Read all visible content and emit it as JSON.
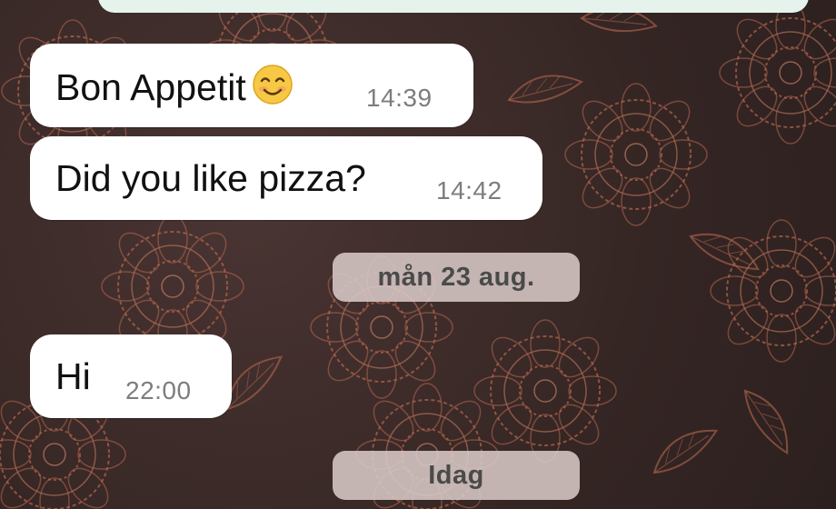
{
  "messages": [
    {
      "text": "Bon Appetit",
      "emoji": "smiling-face-emoji",
      "time": "14:39"
    },
    {
      "text": "Did you like pizza?",
      "time": "14:42"
    },
    {
      "text": "Hi",
      "time": "22:00"
    }
  ],
  "date_separators": [
    "mån 23 aug.",
    "Idag"
  ],
  "colors": {
    "bubble": "#ffffff",
    "timestamp": "#7d7d7d",
    "date_chip_bg": "#d7c8c6",
    "wallpaper": "#352624",
    "wallpaper_lace": "#b5674f",
    "top_bubble": "#e6f3ec"
  }
}
